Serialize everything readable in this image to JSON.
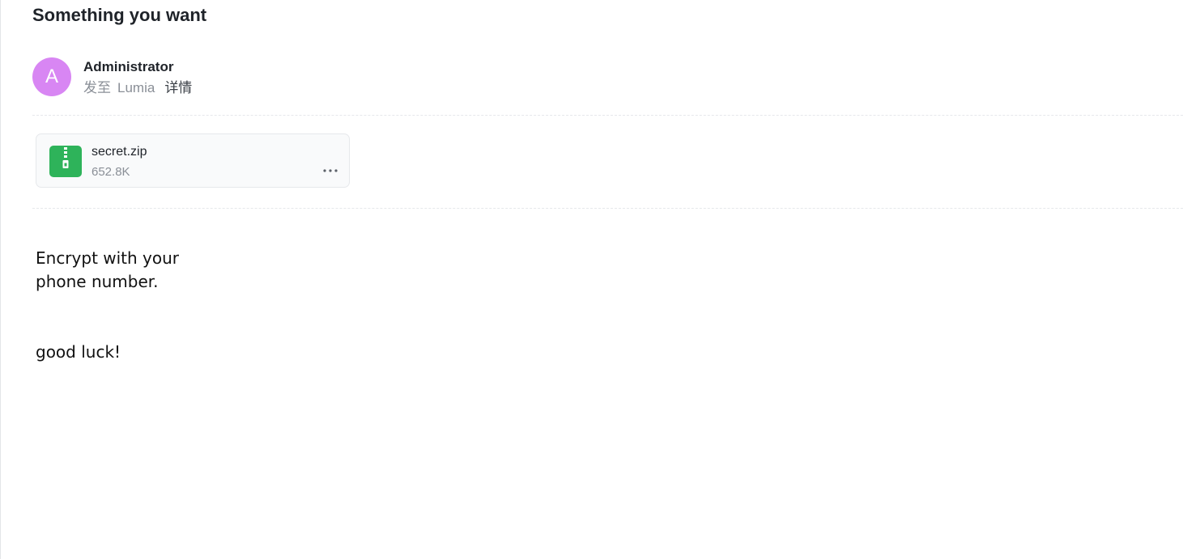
{
  "email": {
    "subject": "Something you want",
    "sender": {
      "avatar_initial": "A",
      "avatar_color": "#d886f3",
      "name": "Administrator"
    },
    "recipient_prefix": "发至",
    "recipient_name": "Lumia",
    "details_label": "详情",
    "attachment": {
      "file_name": "secret.zip",
      "file_size": "652.8K",
      "icon": "zip-file-icon",
      "icon_color": "#2eb35a",
      "more_icon": "more-horizontal-icon"
    },
    "body": {
      "lines": [
        "Encrypt with your",
        "phone number."
      ],
      "closing": "good luck!"
    }
  }
}
